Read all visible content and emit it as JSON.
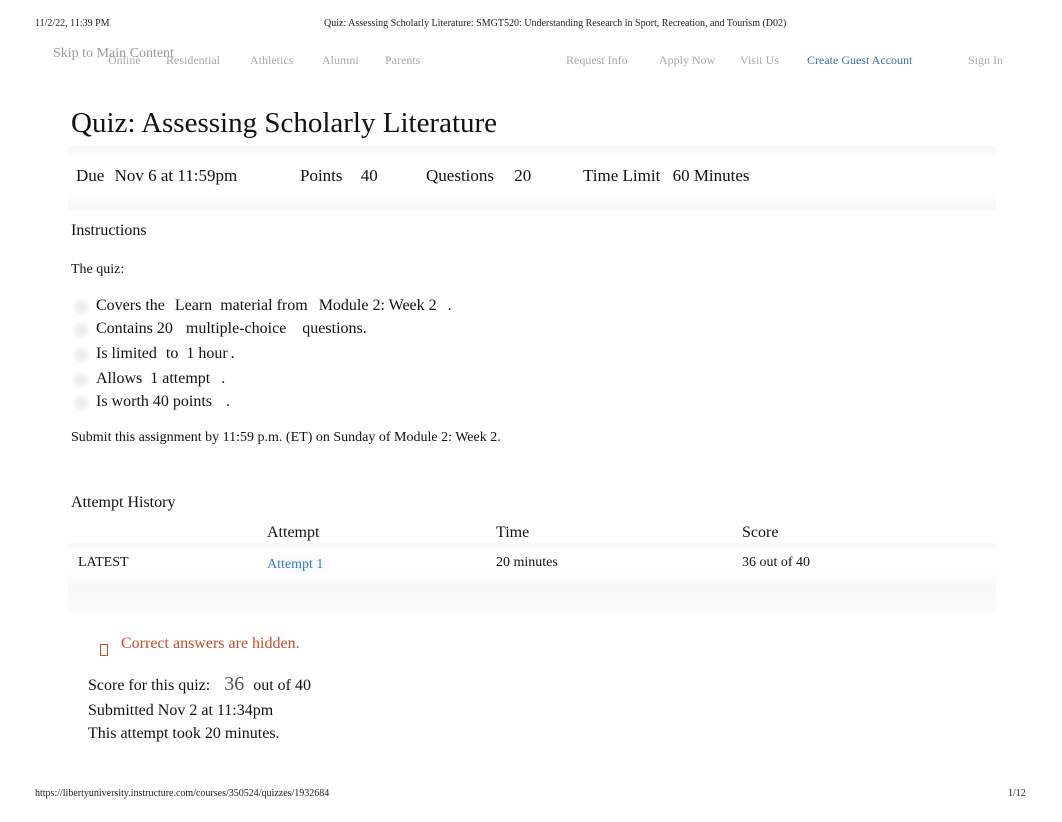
{
  "print_header": {
    "datetime": "11/2/22, 11:39 PM",
    "doc_title": "Quiz: Assessing Scholarly Literature: SMGT520: Understanding Research in Sport, Recreation, and Tourism (D02)"
  },
  "nav": {
    "skip_link": "Skip to Main Content",
    "left_items": [
      "Online",
      "Residential",
      "Athletics",
      "Alumni",
      "Parents"
    ],
    "right_items": [
      "Request Info",
      "Apply Now",
      "Visit Us"
    ],
    "create_account": "Create Guest Account",
    "sign_in": "Sign In",
    "accent_color": "#3b6ea5"
  },
  "quiz": {
    "title": "Quiz: Assessing Scholarly Literature",
    "details": {
      "due_label": "Due",
      "due_value": "Nov 6 at 11:59pm",
      "points_label": "Points",
      "points_value": "40",
      "questions_label": "Questions",
      "questions_value": "20",
      "time_limit_label": "Time Limit",
      "time_limit_value": "60 Minutes"
    },
    "instructions": {
      "heading": "Instructions",
      "intro": "The quiz:",
      "items": [
        {
          "parts": [
            "Covers the",
            "Learn",
            "material from",
            "Module 2: Week 2",
            "."
          ]
        },
        {
          "parts": [
            "Contains 20",
            "multiple-choice",
            "questions."
          ]
        },
        {
          "parts": [
            "Is limited",
            "to",
            "1 hour",
            "."
          ]
        },
        {
          "parts": [
            "Allows",
            "1 attempt",
            "."
          ]
        },
        {
          "parts": [
            "Is worth 40 points",
            "."
          ]
        }
      ],
      "submit_note": "Submit this assignment by 11:59 p.m. (ET) on Sunday of Module 2: Week 2."
    },
    "attempt_history": {
      "heading": "Attempt History",
      "columns": [
        "",
        "Attempt",
        "Time",
        "Score"
      ],
      "rows": [
        {
          "label": "LATEST",
          "attempt": "Attempt 1",
          "time": "20 minutes",
          "score": "36 out of 40"
        }
      ],
      "link_color": "#3a7bc8"
    },
    "result": {
      "warning_icon": "warning-icon",
      "warning": "Correct answers are hidden.",
      "warning_color": "#c24e2b",
      "score_label": "Score for this quiz:",
      "score_value": "36",
      "score_suffix": "out of 40",
      "submitted": "Submitted Nov 2 at 11:34pm",
      "duration": "This attempt took 20 minutes."
    }
  },
  "print_footer": {
    "url": "https://libertyuniversity.instructure.com/courses/350524/quizzes/1932684",
    "page": "1/12"
  }
}
